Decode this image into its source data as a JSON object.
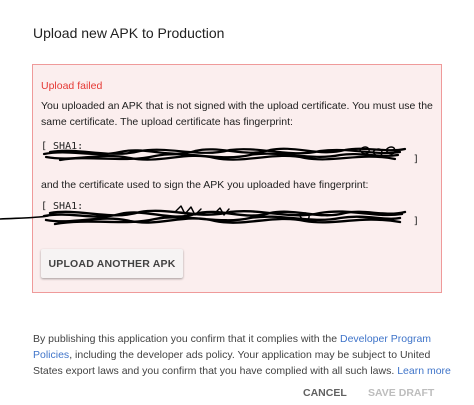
{
  "dialog": {
    "title": "Upload new APK to Production"
  },
  "error": {
    "title": "Upload failed",
    "message_line1": "You uploaded an APK that is not signed with the upload certificate. You must use the",
    "message_line2": "same certificate. The upload certificate has fingerprint:",
    "fingerprint1_prefix": "[ SHA1:",
    "fingerprint1_suffix": "]",
    "message_line3": "and the certificate used to sign the APK you uploaded have fingerprint:",
    "fingerprint2_prefix": "[ SHA1:",
    "fingerprint2_suffix": "]",
    "upload_button_label": "UPLOAD ANOTHER APK"
  },
  "policy": {
    "line1_text": "By publishing this application you confirm that it complies with the ",
    "link1_part1": "Developer Program",
    "link1_part2": "Policies",
    "line2_text": ", including the developer ads policy. Your application may be subject to United",
    "line3_text": "States export laws and you confirm that you have complied with all such laws. ",
    "learn_more": "Learn more"
  },
  "footer": {
    "cancel_label": "CANCEL",
    "save_draft_label": "SAVE DRAFT"
  },
  "colors": {
    "error_red": "#e53935",
    "error_border": "#ef9a9a",
    "error_background": "#fbeeee",
    "link_blue": "#3f74c9",
    "disabled_text": "#bdbdbd"
  }
}
